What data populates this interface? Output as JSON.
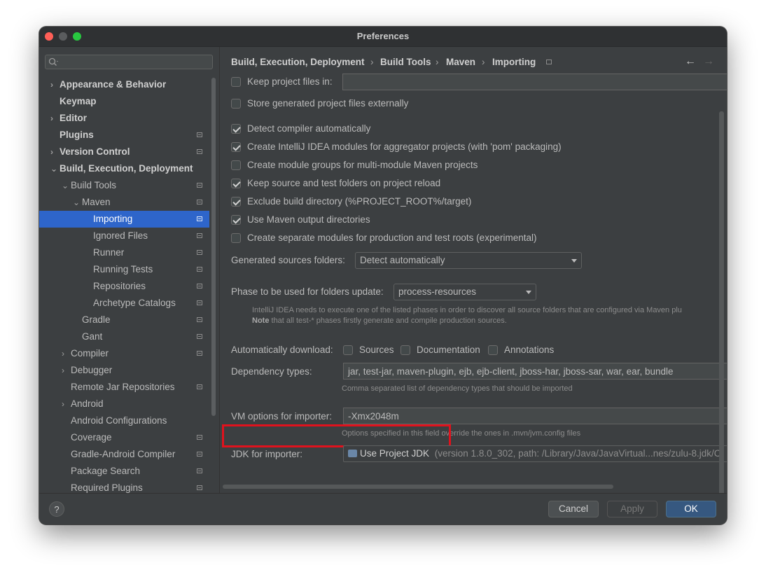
{
  "window": {
    "title": "Preferences"
  },
  "sidebar": {
    "search_placeholder": "",
    "items": [
      {
        "label": "Appearance & Behavior",
        "bold": true,
        "arrow": "›",
        "level": 0,
        "icon": false
      },
      {
        "label": "Keymap",
        "bold": true,
        "arrow": "",
        "level": 0,
        "icon": false
      },
      {
        "label": "Editor",
        "bold": true,
        "arrow": "›",
        "level": 0,
        "icon": false
      },
      {
        "label": "Plugins",
        "bold": true,
        "arrow": "",
        "level": 0,
        "icon": true
      },
      {
        "label": "Version Control",
        "bold": true,
        "arrow": "›",
        "level": 0,
        "icon": true
      },
      {
        "label": "Build, Execution, Deployment",
        "bold": true,
        "arrow": "⌄",
        "level": 0,
        "icon": false
      },
      {
        "label": "Build Tools",
        "bold": false,
        "arrow": "⌄",
        "level": 1,
        "icon": true
      },
      {
        "label": "Maven",
        "bold": false,
        "arrow": "⌄",
        "level": 2,
        "icon": true
      },
      {
        "label": "Importing",
        "bold": false,
        "arrow": "",
        "level": 3,
        "icon": true,
        "selected": true
      },
      {
        "label": "Ignored Files",
        "bold": false,
        "arrow": "",
        "level": 3,
        "icon": true
      },
      {
        "label": "Runner",
        "bold": false,
        "arrow": "",
        "level": 3,
        "icon": true
      },
      {
        "label": "Running Tests",
        "bold": false,
        "arrow": "",
        "level": 3,
        "icon": true
      },
      {
        "label": "Repositories",
        "bold": false,
        "arrow": "",
        "level": 3,
        "icon": true
      },
      {
        "label": "Archetype Catalogs",
        "bold": false,
        "arrow": "",
        "level": 3,
        "icon": true
      },
      {
        "label": "Gradle",
        "bold": false,
        "arrow": "",
        "level": 2,
        "icon": true
      },
      {
        "label": "Gant",
        "bold": false,
        "arrow": "",
        "level": 2,
        "icon": true
      },
      {
        "label": "Compiler",
        "bold": false,
        "arrow": "›",
        "level": 1,
        "icon": true
      },
      {
        "label": "Debugger",
        "bold": false,
        "arrow": "›",
        "level": 1,
        "icon": false
      },
      {
        "label": "Remote Jar Repositories",
        "bold": false,
        "arrow": "",
        "level": 1,
        "icon": true
      },
      {
        "label": "Android",
        "bold": false,
        "arrow": "›",
        "level": 1,
        "icon": false
      },
      {
        "label": "Android Configurations",
        "bold": false,
        "arrow": "",
        "level": 1,
        "icon": false
      },
      {
        "label": "Coverage",
        "bold": false,
        "arrow": "",
        "level": 1,
        "icon": true
      },
      {
        "label": "Gradle-Android Compiler",
        "bold": false,
        "arrow": "",
        "level": 1,
        "icon": true
      },
      {
        "label": "Package Search",
        "bold": false,
        "arrow": "",
        "level": 1,
        "icon": true
      },
      {
        "label": "Required Plugins",
        "bold": false,
        "arrow": "",
        "level": 1,
        "icon": true
      }
    ]
  },
  "breadcrumb": {
    "c1": "Build, Execution, Deployment",
    "c2": "Build Tools",
    "c3": "Maven",
    "c4": "Importing",
    "sep": "›"
  },
  "nav": {
    "back": "←",
    "forward": "→"
  },
  "settings": {
    "keep_project_files": {
      "label": "Keep project files in:",
      "checked": false,
      "value": ""
    },
    "store_generated": {
      "label": "Store generated project files externally",
      "checked": false
    },
    "checkboxes": [
      {
        "label": "Detect compiler automatically",
        "checked": true
      },
      {
        "label": "Create IntelliJ IDEA modules for aggregator projects (with 'pom' packaging)",
        "checked": true
      },
      {
        "label": "Create module groups for multi-module Maven projects",
        "checked": false
      },
      {
        "label": "Keep source and test folders on project reload",
        "checked": true
      },
      {
        "label": "Exclude build directory (%PROJECT_ROOT%/target)",
        "checked": true
      },
      {
        "label": "Use Maven output directories",
        "checked": true
      },
      {
        "label": "Create separate modules for production and test roots (experimental)",
        "checked": false
      }
    ],
    "generated_sources": {
      "label": "Generated sources folders:",
      "value": "Detect automatically"
    },
    "phase": {
      "label": "Phase to be used for folders update:",
      "value": "process-resources"
    },
    "phase_hint_line1": "IntelliJ IDEA needs to execute one of the listed phases in order to discover all source folders that are configured via Maven plu",
    "phase_hint_note": "Note",
    "phase_hint_line2": " that all test-* phases firstly generate and compile production sources.",
    "auto_download": {
      "label": "Automatically download:",
      "sources": {
        "label": "Sources",
        "checked": false
      },
      "documentation": {
        "label": "Documentation",
        "checked": false
      },
      "annotations": {
        "label": "Annotations",
        "checked": false
      }
    },
    "dependency_types": {
      "label": "Dependency types:",
      "value": "jar, test-jar, maven-plugin, ejb, ejb-client, jboss-har, jboss-sar, war, ear, bundle",
      "hint": "Comma separated list of dependency types that should be imported"
    },
    "vm_options": {
      "label": "VM options for importer:",
      "value": "-Xmx2048m",
      "hint": "Options specified in this field override the ones in .mvn/jvm.config files"
    },
    "jdk": {
      "label": "JDK for importer:",
      "value": "Use Project JDK",
      "detail": "(version 1.8.0_302, path: /Library/Java/JavaVirtual...nes/zulu-8.jdk/C"
    }
  },
  "footer": {
    "help": "?",
    "cancel": "Cancel",
    "apply": "Apply",
    "ok": "OK"
  },
  "colors": {
    "accent": "#2e65ca",
    "highlight_box": "#e0121d",
    "primary_button": "#365880"
  }
}
